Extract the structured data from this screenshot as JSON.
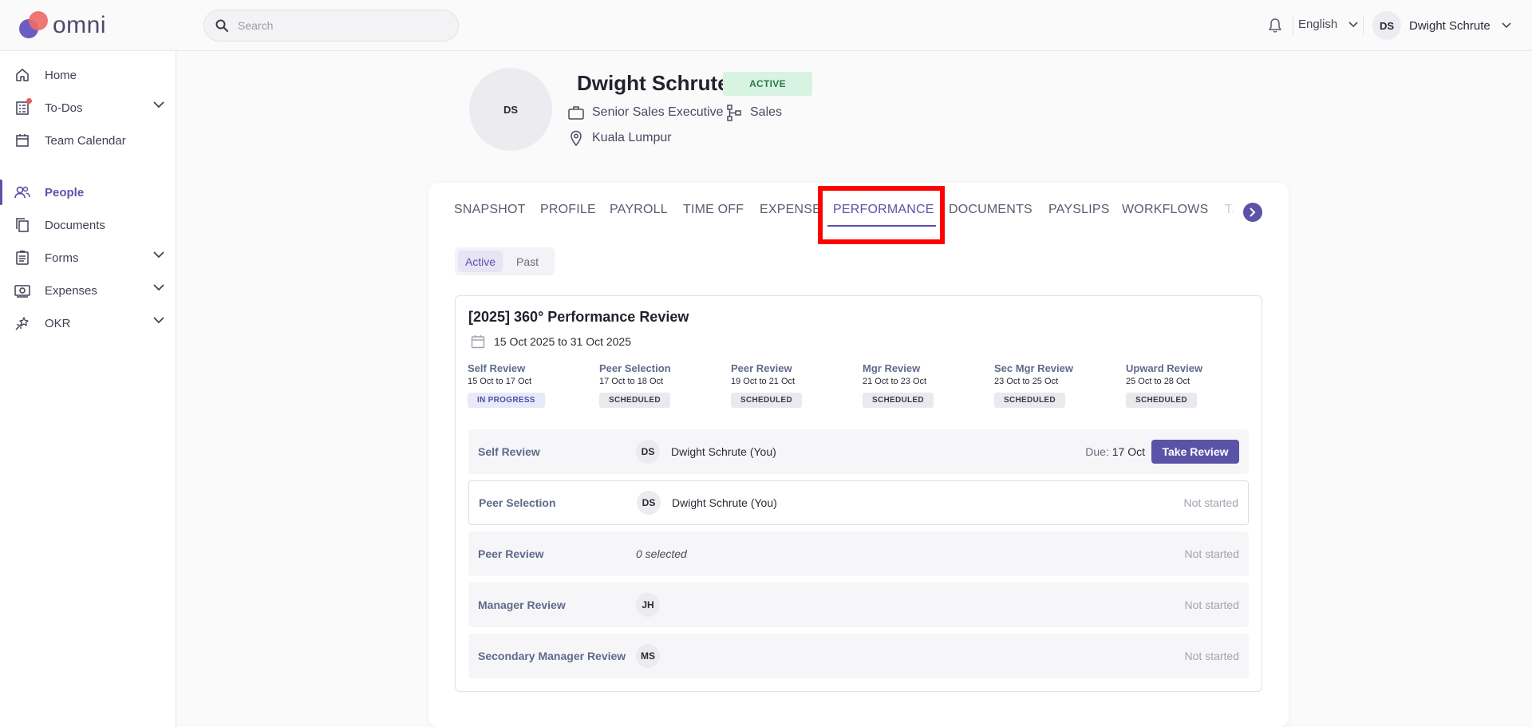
{
  "header": {
    "logo_text": "omni",
    "search_placeholder": "Search",
    "language": "English",
    "user_initials": "DS",
    "user_name": "Dwight Schrute"
  },
  "sidebar": {
    "items": [
      {
        "label": "Home",
        "icon": "home-icon"
      },
      {
        "label": "To-Dos",
        "icon": "todo-list-icon",
        "expandable": true,
        "notification": true
      },
      {
        "label": "Team Calendar",
        "icon": "calendar-icon"
      },
      {
        "label": "People",
        "icon": "people-icon",
        "active": true
      },
      {
        "label": "Documents",
        "icon": "documents-icon"
      },
      {
        "label": "Forms",
        "icon": "form-icon",
        "expandable": true
      },
      {
        "label": "Expenses",
        "icon": "money-icon",
        "expandable": true
      },
      {
        "label": "OKR",
        "icon": "okr-icon",
        "expandable": true
      }
    ]
  },
  "profile": {
    "initials": "DS",
    "name": "Dwight Schrute",
    "status": "ACTIVE",
    "title": "Senior Sales Executive",
    "department": "Sales",
    "location": "Kuala Lumpur"
  },
  "tabs": [
    "SNAPSHOT",
    "PROFILE",
    "PAYROLL",
    "TIME OFF",
    "EXPENSE",
    "PERFORMANCE",
    "DOCUMENTS",
    "PAYSLIPS",
    "WORKFLOWS",
    "TA"
  ],
  "active_tab": "PERFORMANCE",
  "segment": {
    "active": "Active",
    "past": "Past"
  },
  "review": {
    "title": "[2025] 360° Performance Review",
    "dates": "15 Oct 2025 to 31 Oct 2025",
    "stages": [
      {
        "name": "Self Review",
        "range": "15 Oct to 17 Oct",
        "status": "IN PROGRESS"
      },
      {
        "name": "Peer Selection",
        "range": "17 Oct to 18 Oct",
        "status": "SCHEDULED"
      },
      {
        "name": "Peer Review",
        "range": "19 Oct to 21 Oct",
        "status": "SCHEDULED"
      },
      {
        "name": "Mgr Review",
        "range": "21 Oct to 23 Oct",
        "status": "SCHEDULED"
      },
      {
        "name": "Sec Mgr Review",
        "range": "23 Oct to 25 Oct",
        "status": "SCHEDULED"
      },
      {
        "name": "Upward Review",
        "range": "25 Oct to 28 Oct",
        "status": "SCHEDULED"
      }
    ],
    "rows": [
      {
        "label": "Self Review",
        "initials": "DS",
        "person": "Dwight Schrute (You)",
        "due_label": "Due:",
        "due_value": "17 Oct",
        "action": "Take Review"
      },
      {
        "label": "Peer Selection",
        "initials": "DS",
        "person": "Dwight Schrute (You)",
        "status": "Not started"
      },
      {
        "label": "Peer Review",
        "selected": "0 selected",
        "status": "Not started"
      },
      {
        "label": "Manager Review",
        "initials": "JH",
        "status": "Not started"
      },
      {
        "label": "Secondary Manager Review",
        "initials": "MS",
        "status": "Not started"
      }
    ]
  },
  "colors": {
    "accent": "#5b53a8",
    "active_badge_bg": "#d8f3e2",
    "highlight": "#ff0000"
  }
}
